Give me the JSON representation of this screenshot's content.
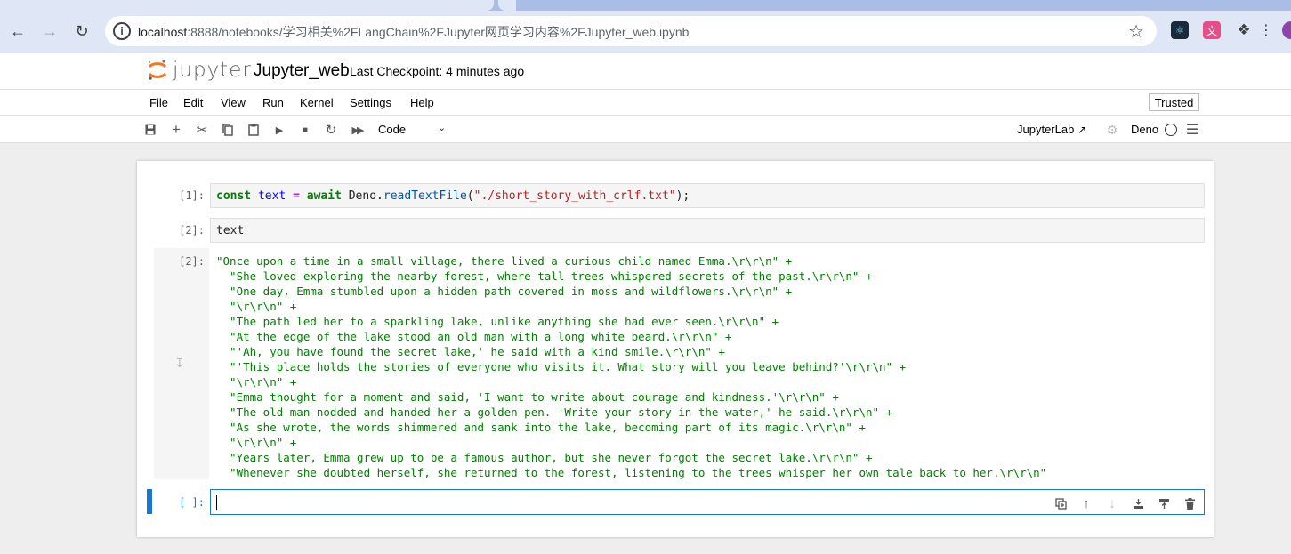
{
  "browser": {
    "url_host": "localhost",
    "url_path": ":8888/notebooks/学习相关%2FLangChain%2FJupyter网页学习内容%2FJupyter_web.ipynb"
  },
  "header": {
    "logo_text": "jupyter",
    "notebook_title": "Jupyter_web",
    "checkpoint": "Last Checkpoint: 4 minutes ago"
  },
  "menu": {
    "items": [
      "File",
      "Edit",
      "View",
      "Run",
      "Kernel",
      "Settings",
      "Help"
    ],
    "trusted": "Trusted"
  },
  "toolbar": {
    "cell_type": "Code",
    "jupyterlab_label": "JupyterLab",
    "kernel_name": "Deno"
  },
  "cells": [
    {
      "prompt": "[1]:",
      "code_parts": {
        "kw1": "const",
        "var": "text",
        "op": "=",
        "kw2": "await",
        "obj": "Deno.",
        "fn": "readTextFile",
        "open": "(",
        "str": "\"./short_story_with_crlf.txt\"",
        "close": ");"
      }
    },
    {
      "prompt": "[2]:",
      "code": "text",
      "output_prompt": "[2]:",
      "output": "\"Once upon a time in a small village, there lived a curious child named Emma.\\r\\r\\n\" +\n  \"She loved exploring the nearby forest, where tall trees whispered secrets of the past.\\r\\r\\n\" +\n  \"One day, Emma stumbled upon a hidden path covered in moss and wildflowers.\\r\\r\\n\" +\n  \"\\r\\r\\n\" +\n  \"The path led her to a sparkling lake, unlike anything she had ever seen.\\r\\r\\n\" +\n  \"At the edge of the lake stood an old man with a long white beard.\\r\\r\\n\" +\n  \"'Ah, you have found the secret lake,' he said with a kind smile.\\r\\r\\n\" +\n  \"'This place holds the stories of everyone who visits it. What story will you leave behind?'\\r\\r\\n\" +\n  \"\\r\\r\\n\" +\n  \"Emma thought for a moment and said, 'I want to write about courage and kindness.'\\r\\r\\n\" +\n  \"The old man nodded and handed her a golden pen. 'Write your story in the water,' he said.\\r\\r\\n\" +\n  \"As she wrote, the words shimmered and sank into the lake, becoming part of its magic.\\r\\r\\n\" +\n  \"\\r\\r\\n\" +\n  \"Years later, Emma grew up to be a famous author, but she never forgot the secret lake.\\r\\r\\n\" +\n  \"Whenever she doubted herself, she returned to the forest, listening to the trees whisper her own tale back to her.\\r\\r\\n\""
    },
    {
      "prompt": "[ ]:",
      "code": ""
    }
  ]
}
